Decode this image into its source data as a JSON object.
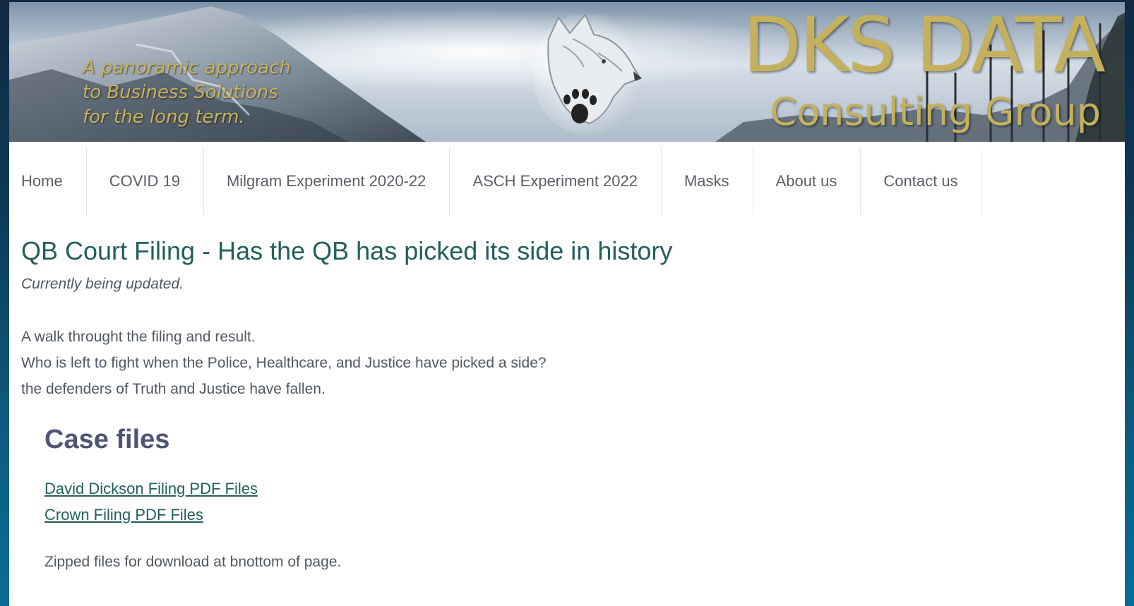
{
  "banner": {
    "tagline": [
      "A panoramic approach",
      "to Business Solutions",
      "for the long term."
    ],
    "brand_name": "DKS DATA",
    "brand_subtitle": "Consulting Group"
  },
  "nav": {
    "items": [
      {
        "label": "Home"
      },
      {
        "label": "COVID 19"
      },
      {
        "label": "Milgram Experiment 2020-22"
      },
      {
        "label": "ASCH Experiment 2022"
      },
      {
        "label": "Masks"
      },
      {
        "label": "About us"
      },
      {
        "label": "Contact us"
      }
    ]
  },
  "main": {
    "title": "QB Court Filing - Has the QB has picked its side in history",
    "status": "Currently being updated.",
    "intro": [
      "A walk throught the filing and result.",
      "Who is left to fight when the Police, Healthcare, and Justice have picked a side?",
      "the defenders of Truth and Justice have fallen."
    ],
    "case_files": {
      "heading": "Case files",
      "links": [
        {
          "label": "David Dickson Filing PDF Files"
        },
        {
          "label": "Crown Filing PDF Files"
        }
      ],
      "note": "Zipped files for download at bnottom of page."
    }
  },
  "colors": {
    "brand_gold": "#c5b15d",
    "title_teal": "#225f5c",
    "heading_slate": "#4f5474",
    "body_text": "#505861"
  }
}
